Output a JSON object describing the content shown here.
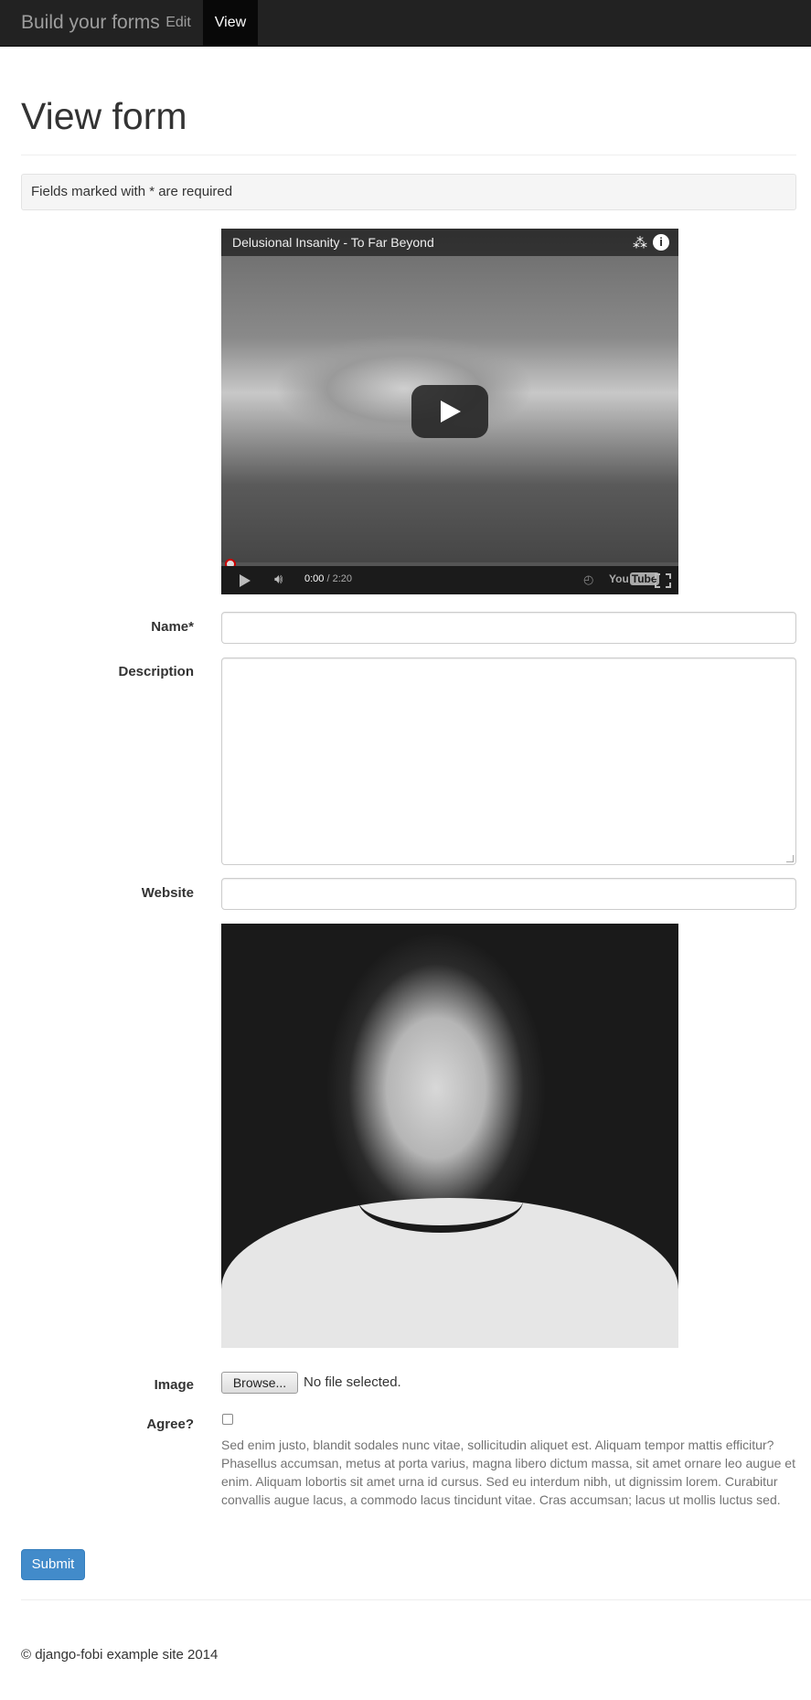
{
  "navbar": {
    "brand": "Build your forms",
    "items": [
      {
        "label": "Edit"
      },
      {
        "label": "View",
        "active": true
      }
    ]
  },
  "page": {
    "title": "View form",
    "required_notice": "Fields marked with * are required"
  },
  "video": {
    "title": "Delusional Insanity - To Far Beyond",
    "current_time": "0:00",
    "duration": "/ 2:20",
    "progress": 0,
    "icons": [
      "share-icon",
      "info-icon",
      "play-icon",
      "volume-icon",
      "watch-later-icon",
      "youtube-logo",
      "fullscreen-icon"
    ],
    "logo_text": "You",
    "logo_tube": "Tube"
  },
  "form": {
    "name_label": "Name*",
    "name_value": "",
    "description_label": "Description",
    "description_value": "",
    "website_label": "Website",
    "website_value": "",
    "image_label": "Image",
    "browse_label": "Browse...",
    "file_status": "No file selected.",
    "agree_label": "Agree?",
    "agree_checked": false,
    "agree_help": "Sed enim justo, blandit sodales nunc vitae, sollicitudin aliquet est. Aliquam tempor mattis efficitur? Phasellus accumsan, metus at porta varius, magna libero dictum massa, sit amet ornare leo augue et enim. Aliquam lobortis sit amet urna id cursus. Sed eu interdum nibh, ut dignissim lorem. Curabitur convallis augue lacus, a commodo lacus tincidunt vitae. Cras accumsan; lacus ut mollis luctus sed.",
    "submit_label": "Submit"
  },
  "footer": {
    "text": "© django-fobi example site 2014"
  },
  "colors": {
    "navbar_bg": "#222222",
    "nav_active_bg": "#080808",
    "primary": "#428bca",
    "help_text": "#737373"
  }
}
